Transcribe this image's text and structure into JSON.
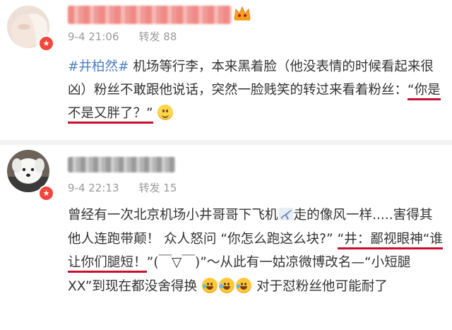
{
  "posts": [
    {
      "date": "9-4 21:06",
      "repost_label": "转发",
      "repost_count": "88",
      "badge": "★",
      "content": {
        "hashtag": "#井柏然#",
        "text_before": " 机场等行李，本来黑着脸（他没表情的时候看起来很凶）粉丝不敢跟他说话，突然一脸贱笑的转过来看着粉丝：",
        "highlight": "“你是不是又胖了？”",
        "emoji": "smile-emoji"
      }
    },
    {
      "date": "9-4 22:13",
      "repost_label": "转发",
      "repost_count": "15",
      "badge": "★",
      "content": {
        "text_a": "曾经有一次北京机场小井哥哥下飞机",
        "plane_icon": "airplane-icon",
        "text_b": "走的像风一样.....害得其他人连跑带颠！ 众人怒问 “你怎么跑这么块?” ",
        "highlight": "“井：鄙视眼神“谁让你们腿短！",
        "text_c": "”(￣▽￣)”～从此有一姑凉微博改名—“小短腿XX”到现在都没舍得换",
        "emoji": "laugh-emoji",
        "text_d": " 对于怼粉丝他可能耐了"
      }
    }
  ],
  "colors": {
    "hashtag": "#4a7fc1",
    "underline": "#c8102e",
    "badge": "#f1473d",
    "meta": "#9a9a9a"
  }
}
